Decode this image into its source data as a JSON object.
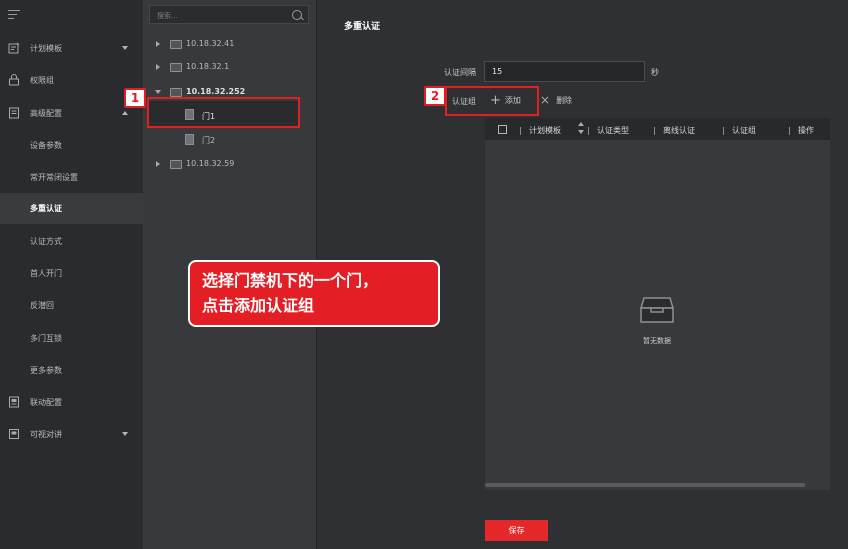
{
  "nav": {
    "items": [
      {
        "label": "计划模板",
        "icon": "calendar-icon",
        "chevron": "down"
      },
      {
        "label": "权限组",
        "icon": "lock-icon"
      },
      {
        "label": "高级配置",
        "icon": "config-icon",
        "chevron": "up"
      },
      {
        "label": "设备参数"
      },
      {
        "label": "常开常闭设置"
      },
      {
        "label": "多重认证"
      },
      {
        "label": "认证方式"
      },
      {
        "label": "首人开门"
      },
      {
        "label": "反潜回"
      },
      {
        "label": "多门互锁"
      },
      {
        "label": "更多参数"
      },
      {
        "label": "联动配置",
        "icon": "linkage-icon"
      },
      {
        "label": "可视对讲",
        "icon": "intercom-icon",
        "chevron": "down"
      }
    ]
  },
  "tree": {
    "search_placeholder": "搜索...",
    "devices": [
      {
        "ip": "10.18.32.41"
      },
      {
        "ip": "10.18.32.1"
      },
      {
        "ip": "10.18.32.252",
        "doors": [
          "门1",
          "门2"
        ]
      },
      {
        "ip": "10.18.32.59"
      }
    ]
  },
  "main": {
    "title": "多重认证",
    "interval_label": "认证间隔",
    "interval_value": "15",
    "interval_unit": "秒",
    "group_label": "认证组",
    "add_label": "添加",
    "delete_label": "删除",
    "columns": [
      "计划模板",
      "认证类型",
      "离线认证",
      "认证组",
      "操作"
    ],
    "empty_text": "暂无数据",
    "save_label": "保存"
  },
  "annotations": {
    "badge1": "1",
    "badge2": "2",
    "callout_line1": "选择门禁机下的一个门，",
    "callout_line2": "点击添加认证组",
    "color": "#e02020"
  }
}
